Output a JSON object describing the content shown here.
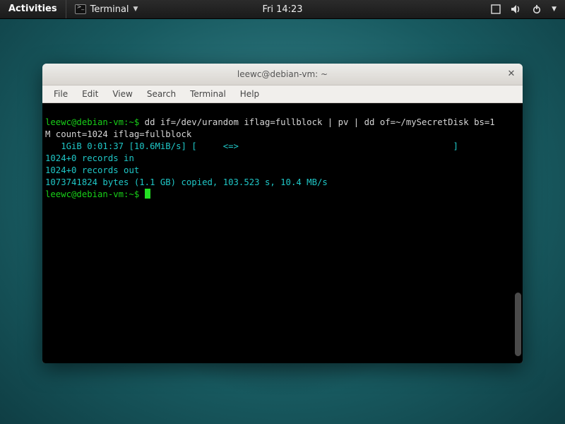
{
  "topbar": {
    "activities_label": "Activities",
    "app_label": "Terminal",
    "clock": "Fri 14:23"
  },
  "window": {
    "title": "leewc@debian-vm: ~",
    "menu": {
      "file": "File",
      "edit": "Edit",
      "view": "View",
      "search": "Search",
      "terminal": "Terminal",
      "help": "Help"
    }
  },
  "terminal": {
    "prompt": "leewc@debian-vm:~$",
    "cmd1_a": "dd if=/dev/urandom iflag=fullblock | pv | dd of=~/mySecretDisk bs=1",
    "cmd1_b": "M count=1024 iflag=fullblock",
    "pv_line_a": "   1GiB 0:01:37 [10.6MiB/s] [     <=>                                         ]",
    "out1": "1024+0 records in",
    "out2": "1024+0 records out",
    "out3": "1073741824 bytes (1.1 GB) copied, 103.523 s, 10.4 MB/s"
  }
}
